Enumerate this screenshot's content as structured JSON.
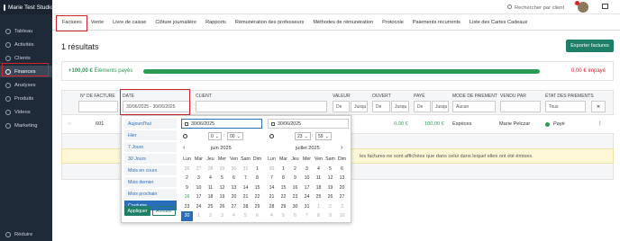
{
  "app": {
    "title": "Marie Test Studio",
    "search_placeholder": "Rechercher par client"
  },
  "sidebar": {
    "items": [
      {
        "label": "Tableau",
        "icon": "dashboard-icon"
      },
      {
        "label": "Activités",
        "icon": "activity-icon"
      },
      {
        "label": "Clients",
        "icon": "clients-icon"
      },
      {
        "label": "Finances",
        "icon": "euro-icon",
        "active": true
      },
      {
        "label": "Analyses",
        "icon": "chart-icon"
      },
      {
        "label": "Produits",
        "icon": "products-icon"
      },
      {
        "label": "Videos",
        "icon": "video-icon"
      },
      {
        "label": "Marketing",
        "icon": "megaphone-icon"
      }
    ],
    "collapse_label": "Réduire"
  },
  "tabs": [
    "Factures",
    "Vente",
    "Livre de caisse",
    "Clôture journalière",
    "Rapports",
    "Rémunération des professeurs",
    "Méthodes de rémunération",
    "Protocole",
    "Paiements récurrents",
    "Liste des Cartes Cadeaux"
  ],
  "active_tab": "Factures",
  "page": {
    "title": "1 résultats",
    "export_label": "Exporter factures"
  },
  "summary": {
    "paid_amount": "+100,00 €",
    "paid_label": "Éléments payés",
    "paid_fraction": 1.0,
    "unpaid": "0,00 € Impayé"
  },
  "table": {
    "headers": {
      "number": "N° DE FACTURE",
      "date": "DATE",
      "client": "CLIENT",
      "value": "VALEUR",
      "open": "OUVERT",
      "paid": "PAYÉ",
      "method": "MODE DE PAIEMENT",
      "seller": "VENDU PAR",
      "state": "ÉTAT DES PAIEMENTS"
    },
    "filters": {
      "date_range": "30/06/2025 - 30/06/2025",
      "value_from": "De",
      "value_to": "Jusqu",
      "open_from": "De",
      "open_to": "Jusqu",
      "paid_from": "De",
      "paid_to": "Jusqu",
      "method": "Aucun",
      "state": "Tous"
    },
    "row": {
      "number": "601",
      "open": "0,00 €",
      "paid": "100,00 €",
      "method": "Espèces",
      "seller": "Marie Pelczar",
      "state": "Payé"
    }
  },
  "notice": "les factures ne sont affichées que dans celui dans lequel elles ont été émises.",
  "datepicker": {
    "ranges": [
      "Aujourd'hui",
      "Hier",
      "7 Jours",
      "30 Jours",
      "Mois en cours",
      "Mois dernier",
      "Mois prochain",
      "Coutume"
    ],
    "active_range": "Coutume",
    "apply_label": "Appliquer",
    "cancel_label": "Annuler",
    "start_input": "30/06/2025",
    "end_input": "30/06/2025",
    "start_time": {
      "hour": "0",
      "minute": "00"
    },
    "end_time": {
      "hour": "23",
      "minute": "59"
    },
    "weekdays": [
      "Lun",
      "Mar",
      "Jeu",
      "Mer",
      "Ven",
      "Sam",
      "Dim"
    ],
    "left": {
      "month": "juin 2025",
      "weeks": [
        [
          "26",
          "27",
          "28",
          "29",
          "30",
          "31",
          "1"
        ],
        [
          "2",
          "3",
          "4",
          "5",
          "6",
          "7",
          "8"
        ],
        [
          "9",
          "10",
          "11",
          "12",
          "13",
          "14",
          "15"
        ],
        [
          "16",
          "17",
          "18",
          "19",
          "20",
          "21",
          "22"
        ],
        [
          "23",
          "24",
          "25",
          "26",
          "27",
          "28",
          "29"
        ],
        [
          "30",
          "1",
          "2",
          "3",
          "4",
          "5",
          "6"
        ]
      ]
    },
    "right": {
      "month": "juillet 2025",
      "weeks": [
        [
          "30",
          "1",
          "2",
          "3",
          "4",
          "5",
          "6"
        ],
        [
          "7",
          "8",
          "9",
          "10",
          "11",
          "12",
          "13"
        ],
        [
          "14",
          "15",
          "16",
          "17",
          "18",
          "19",
          "20"
        ],
        [
          "21",
          "22",
          "23",
          "24",
          "25",
          "26",
          "27"
        ],
        [
          "28",
          "29",
          "30",
          "31",
          "1",
          "2",
          "3"
        ],
        [
          "4",
          "5",
          "6",
          "7",
          "8",
          "9",
          "10"
        ]
      ]
    }
  }
}
